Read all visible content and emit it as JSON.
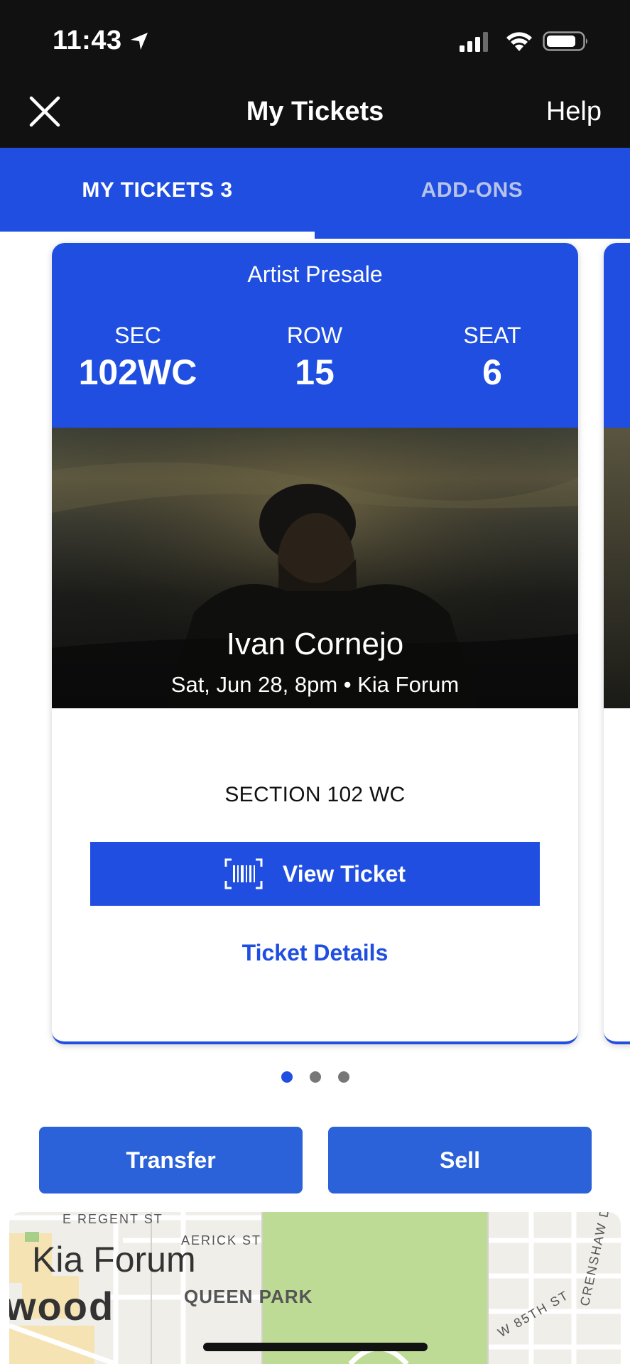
{
  "status_bar": {
    "time": "11:43"
  },
  "header": {
    "title": "My Tickets",
    "help_label": "Help"
  },
  "tabs": [
    {
      "label": "MY TICKETS 3",
      "selected": true
    },
    {
      "label": "ADD-ONS",
      "selected": false
    }
  ],
  "ticket": {
    "presale": "Artist Presale",
    "sec_label": "SEC",
    "sec_value": "102WC",
    "row_label": "ROW",
    "row_value": "15",
    "seat_label": "SEAT",
    "seat_value": "6",
    "artist": "Ivan Cornejo",
    "event_info": "Sat, Jun 28, 8pm • Kia Forum",
    "section": "SECTION 102 WC",
    "view_ticket_label": "View Ticket",
    "details_label": "Ticket Details"
  },
  "pager": {
    "count": 3,
    "active_index": 0
  },
  "actions": {
    "transfer_label": "Transfer",
    "sell_label": "Sell"
  },
  "map": {
    "labels": {
      "regent": "E REGENT ST",
      "aerick": "AERICK ST",
      "venue": "Kia Forum",
      "city_fragment": "wood",
      "park": "QUEEN PARK",
      "street_85th": "W 85TH ST",
      "crenshaw": "CRENSHAW DR"
    }
  },
  "colors": {
    "brand_blue": "#1f4ee0",
    "button_blue": "#2b62d9",
    "header_black": "#111111"
  }
}
